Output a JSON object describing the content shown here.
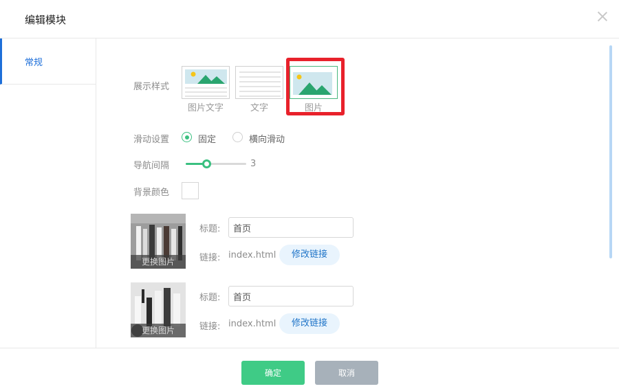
{
  "dialog": {
    "title": "编辑模块"
  },
  "sidebar": {
    "tabs": [
      {
        "label": "常规",
        "active": true
      }
    ]
  },
  "form": {
    "display_style": {
      "label": "展示样式",
      "options": [
        {
          "caption": "图片文字",
          "selected": false
        },
        {
          "caption": "文字",
          "selected": false
        },
        {
          "caption": "图片",
          "selected": true
        }
      ]
    },
    "scroll_setting": {
      "label": "滑动设置",
      "options": [
        {
          "label": "固定",
          "checked": true
        },
        {
          "label": "横向滑动",
          "checked": false
        }
      ]
    },
    "nav_spacing": {
      "label": "导航间隔",
      "value": "3",
      "fill_fraction": 0.34
    },
    "background_color": {
      "label": "背景颜色",
      "value": "#ffffff"
    },
    "nav_items": [
      {
        "title_label": "标题:",
        "title_value": "首页",
        "link_label": "链接:",
        "link_value": "index.html",
        "change_link_label": "修改链接",
        "change_image_label": "更换图片"
      },
      {
        "title_label": "标题:",
        "title_value": "首页",
        "link_label": "链接:",
        "link_value": "index.html",
        "change_link_label": "修改链接",
        "change_image_label": "更换图片"
      }
    ]
  },
  "footer": {
    "confirm_label": "确定",
    "cancel_label": "取消"
  },
  "colors": {
    "accent_green": "#3fcb86",
    "accent_blue": "#1e6fd9",
    "highlight_red": "#e8212b",
    "cancel_gray": "#a7b1ba"
  },
  "icons": {
    "close": "close-icon",
    "image_text_style": "image-text-style-icon",
    "text_style": "text-style-icon",
    "image_style": "image-style-icon"
  }
}
